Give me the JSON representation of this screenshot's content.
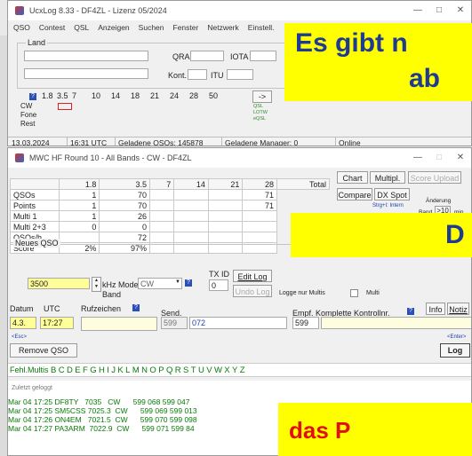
{
  "win1": {
    "title": "UcxLog 8.33 - DF4ZL - Lizenz 05/2024",
    "menu": [
      "QSO",
      "Contest",
      "QSL",
      "Anzeigen",
      "Suchen",
      "Fenster",
      "Netzwerk",
      "Einstell."
    ],
    "land_label": "Land",
    "qra_label": "QRA",
    "iota_label": "IOTA",
    "kont_label": "Kont.",
    "itu_label": "ITU",
    "bands": [
      "1.8",
      "3.5",
      "7",
      "10",
      "14",
      "18",
      "21",
      "24",
      "28",
      "50"
    ],
    "modes": [
      "CW",
      "Fone",
      "Rest"
    ],
    "arrow_label": "->",
    "qsl_tags": [
      "QSL",
      "LOTW",
      "eQSL"
    ],
    "status": {
      "date": "13.03.2024",
      "time": "16:31 UTC",
      "qsos": "Geladene QSOs: 145878",
      "manager": "Geladene Manager: 0",
      "online": "Online"
    }
  },
  "win2": {
    "title": "MWC HF Round 10 - All Bands - CW   - DF4ZL",
    "stats_header": [
      "",
      "1.8",
      "3.5",
      "7",
      "14",
      "21",
      "28",
      "Total"
    ],
    "stats_rows": [
      {
        "label": "QSOs",
        "cells": [
          "",
          "1",
          "70",
          "",
          "",
          "",
          "71"
        ]
      },
      {
        "label": "Points",
        "cells": [
          "",
          "1",
          "70",
          "",
          "",
          "",
          "71"
        ]
      },
      {
        "label": "Multi 1",
        "cells": [
          "",
          "1",
          "26",
          "",
          "",
          "",
          ""
        ]
      },
      {
        "label": "Multi 2+3",
        "cells": [
          "",
          "0",
          "0",
          "",
          "",
          "",
          ""
        ]
      },
      {
        "label": "QSOs/h",
        "cells": [
          "",
          "",
          "72",
          "",
          "",
          "",
          ""
        ]
      },
      {
        "label": "Score",
        "cells": [
          "",
          "2%",
          "97%",
          "",
          "",
          "",
          ""
        ]
      }
    ],
    "btn_chart": "Chart",
    "btn_multipl": "Multipl.",
    "btn_score_upload": "Score Upload",
    "btn_compare": "Compare",
    "btn_dx_spot": "DX Spot",
    "strg_hint": "Strg+I: Intern",
    "aenderung": "Änderung",
    "band_label": "Band",
    "band_min": ">10",
    "min_label": "min",
    "neues_qso": "Neues QSO",
    "freq_value": "3500",
    "khz_label": "kHz",
    "mode_label": "Mode",
    "mode_value": "CW",
    "band_under": "Band",
    "txid_label": "TX ID",
    "txid_value": "0",
    "btn_edit_log": "Edit Log",
    "btn_undo_log": "Undo Log",
    "logge_nur_multis": "Logge nur Multis",
    "multi_label": "Multi",
    "datum_label": "Datum",
    "utc_label": "UTC",
    "rufzeichen_label": "Rufzeichen",
    "send_label": "Send.",
    "empf_label": "Empf.",
    "kontroll_label": "Komplette Kontrollnr.",
    "btn_info": "Info",
    "btn_notiz": "Notiz",
    "datum_value": "4.3.",
    "utc_value": "17:27",
    "send_rst": "599",
    "send_nr": "072",
    "empf_rst": "599",
    "esc_label": "<Esc>",
    "enter_label": "<Enter>",
    "btn_remove": "Remove QSO",
    "btn_log": "Log",
    "fehl_multis": "Fehl.Multis",
    "fehl_letters": "BCDEFGHIJKLMNOPQRSTUVWXYZ",
    "zuletzt": "Zuletzt geloggt",
    "recent": [
      "Mar 04 17:25 DF8TY   7035   CW      599 068 599 047",
      "Mar 04 17:25 SM5CSS 7025.3  CW      599 069 599 013",
      "Mar 04 17:26 ON4EM   7021.5  CW      599 070 599 098",
      "Mar 04 17:27 PA3ARM  7022.9  CW      599 071 599 84"
    ]
  },
  "overlays": {
    "b1_line1": "Es gibt n",
    "b1_line2": "ab",
    "b2_text": "D",
    "b3_text": "das P"
  },
  "colors": {
    "banner_yellow": "#ffff00",
    "banner_blue": "#1f3a93",
    "banner_red": "#e01010",
    "green_text": "#0a7a0a",
    "freq_bg": "#ffff99"
  }
}
